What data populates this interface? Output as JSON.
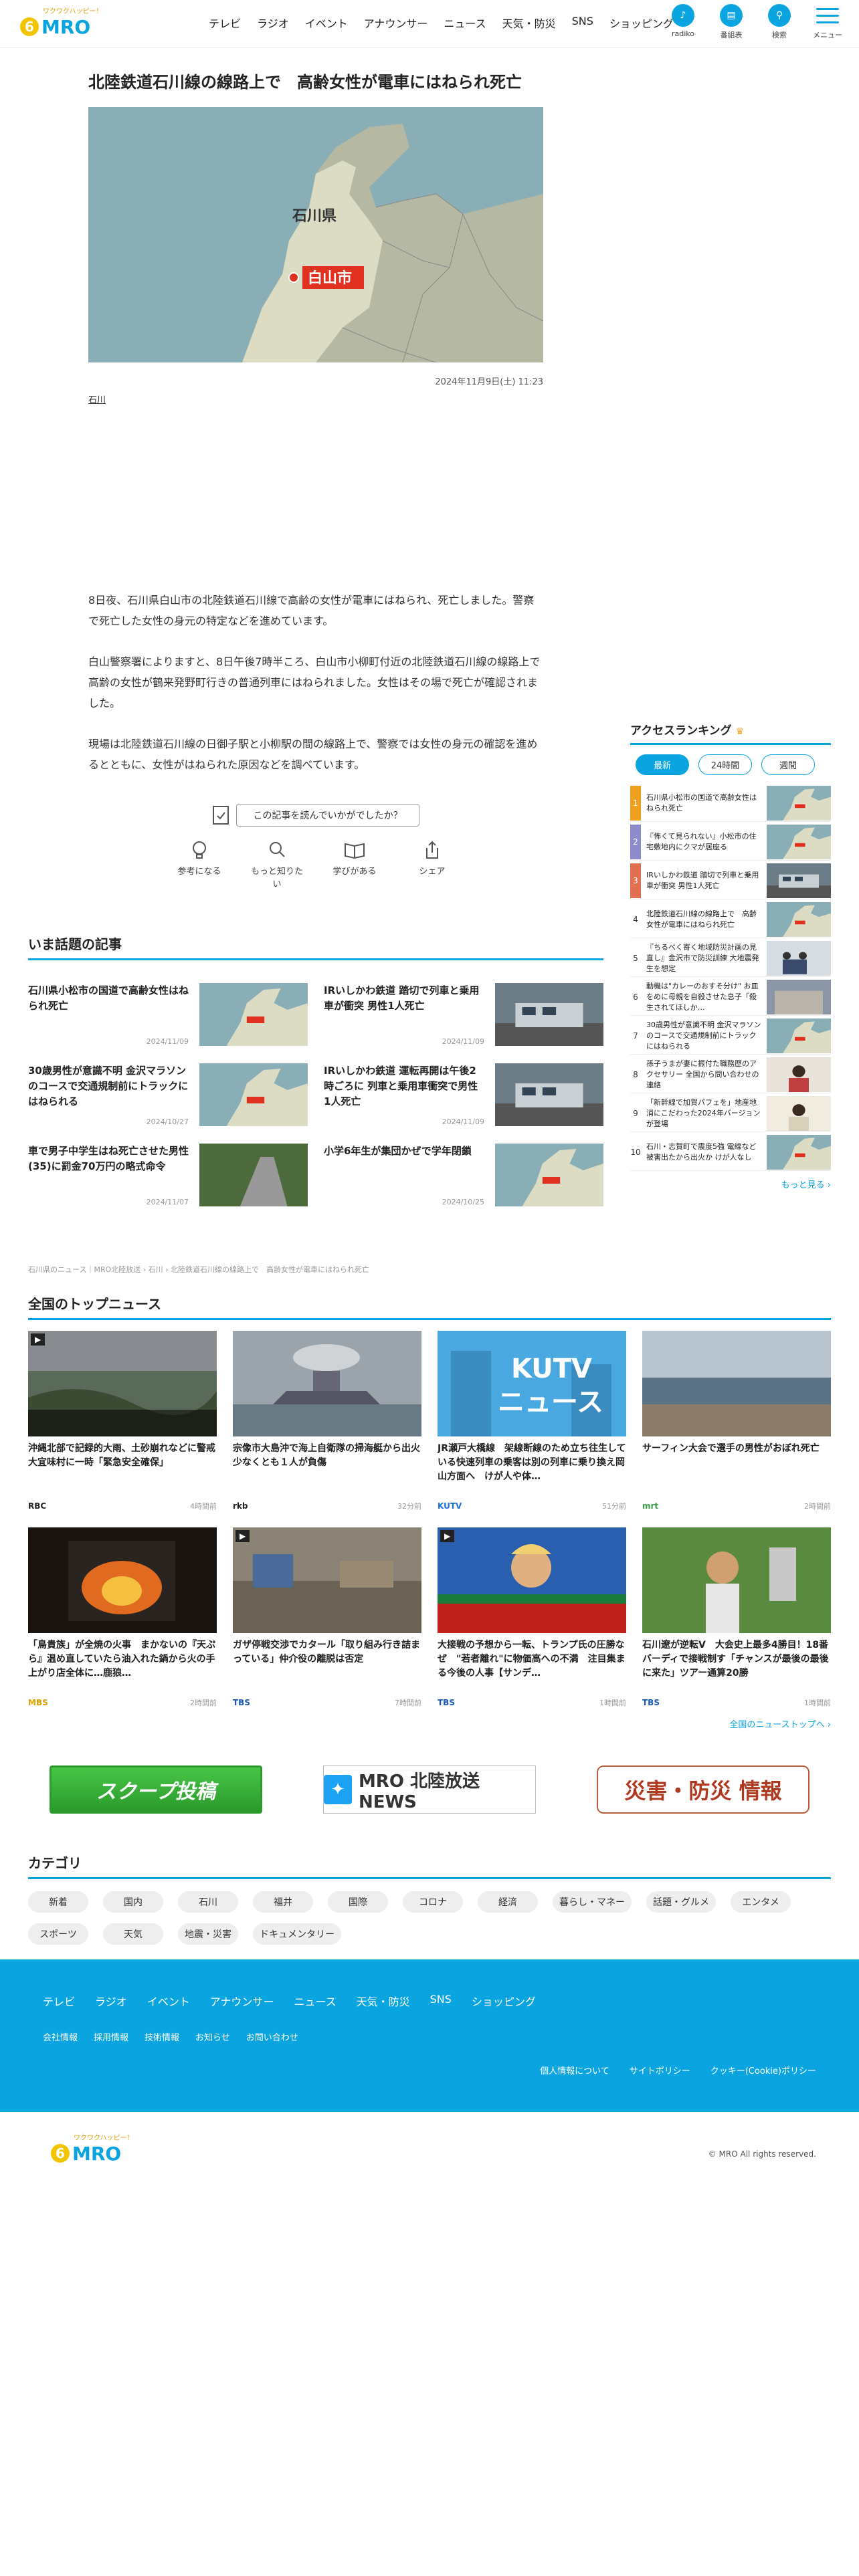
{
  "header": {
    "logo_text": "MRO",
    "logo_tagline": "北陸放送",
    "nav": [
      "テレビ",
      "ラジオ",
      "イベント",
      "アナウンサー",
      "ニュース",
      "天気・防災",
      "SNS",
      "ショッピング"
    ],
    "icons": [
      {
        "label": "radiko",
        "icon": "radio-icon"
      },
      {
        "label": "番組表",
        "icon": "calendar-icon"
      },
      {
        "label": "検索",
        "icon": "search-icon"
      }
    ],
    "menu_label": "メニュー"
  },
  "article": {
    "title": "北陸鉄道石川線の線路上で　高齢女性が電車にはねられ死亡",
    "map_pref_label": "石川県",
    "map_city_label": "白山市",
    "date": "2024年11月9日(土) 11:23",
    "tag": "石川",
    "paragraphs": [
      "8日夜、石川県白山市の北陸鉄道石川線で高齢の女性が電車にはねられ、死亡しました。警察で死亡した女性の身元の特定などを進めています。",
      "白山警察署によりますと、8日午後7時半ころ、白山市小柳町付近の北陸鉄道石川線の線路上で高齢の女性が鶴来発野町行きの普通列車にはねられました。女性はその場で死亡が確認されました。",
      "現場は北陸鉄道石川線の日御子駅と小柳駅の間の線路上で、警察では女性の身元の確認を進めるとともに、女性がはねられた原因などを調べています。"
    ]
  },
  "reaction": {
    "question": "この記事を読んでいかがでしたか？",
    "buttons": [
      {
        "label": "参考になる",
        "icon": "lightbulb-icon"
      },
      {
        "label": "もっと知りたい",
        "icon": "search-icon"
      },
      {
        "label": "学びがある",
        "icon": "book-icon"
      },
      {
        "label": "シェア",
        "icon": "share-icon"
      }
    ]
  },
  "trending": {
    "heading": "いま話題の記事",
    "items": [
      {
        "title": "石川県小松市の国道で高齢女性はねられ死亡",
        "date": "2024/11/09",
        "thumb": "map"
      },
      {
        "title": "IRいしかわ鉄道 踏切で列車と乗用車が衝突 男性1人死亡",
        "date": "2024/11/09",
        "thumb": "train"
      },
      {
        "title": "30歳男性が意識不明 金沢マラソンのコースで交通規制前にトラックにはねられる",
        "date": "2024/10/27",
        "thumb": "map"
      },
      {
        "title": "IRいしかわ鉄道 運転再開は午後2時ごろに 列車と乗用車衝突で男性1人死亡",
        "date": "2024/11/09",
        "thumb": "train"
      },
      {
        "title": "車で男子中学生はね死亡させた男性(35)に罰金70万円の略式命令",
        "date": "2024/11/07",
        "thumb": "road"
      },
      {
        "title": "小学6年生が集団かぜで学年閉鎖",
        "date": "2024/10/25",
        "thumb": "map"
      }
    ]
  },
  "ranking": {
    "heading": "アクセスランキング",
    "tabs": [
      "最新",
      "24時間",
      "週間"
    ],
    "items": [
      {
        "rank": "1",
        "title": "石川県小松市の国道で高齢女性はねられ死亡",
        "color": "#f0a020",
        "thumb": "map"
      },
      {
        "rank": "2",
        "title": "『怖くて見られない』小松市の住宅敷地内にクマが居座る",
        "color": "#8c8ccc",
        "thumb": "map"
      },
      {
        "rank": "3",
        "title": "IRいしかわ鉄道 踏切で列車と乗用車が衝突 男性1人死亡",
        "color": "#e07050",
        "thumb": "train"
      },
      {
        "rank": "4",
        "title": "北陸鉄道石川線の線路上で　高齢女性が電車にはねられ死亡",
        "color": "#ffffff",
        "thumb": "map"
      },
      {
        "rank": "5",
        "title": "『ちるべく寄く地域防災計画の見直し』金沢市で防災訓練 大地震発生を想定",
        "color": "#ffffff",
        "thumb": "people"
      },
      {
        "rank": "6",
        "title": "動機は\"カレーのおすそ分け\" お皿をめに母親を自殺させた息子「殺生されてほしか…",
        "color": "#ffffff",
        "thumb": "building"
      },
      {
        "rank": "7",
        "title": "30歳男性が意識不明 金沢マラソンのコースで交通規制前にトラックにはねられる",
        "color": "#ffffff",
        "thumb": "map"
      },
      {
        "rank": "8",
        "title": "孫子うまが妻に振付た職務歴のアクセサリー 全国から問い合わせの連絡",
        "color": "#ffffff",
        "thumb": "person"
      },
      {
        "rank": "9",
        "title": "「新幹線で加賀パフェを」地産地消にこだわった2024年バージョンが登場",
        "color": "#ffffff",
        "thumb": "person2"
      },
      {
        "rank": "10",
        "title": "石川・志賀町で震度5強 電線など被害出たから出火か けが人なし",
        "color": "#ffffff",
        "thumb": "map"
      }
    ],
    "more": "もっと見る ›"
  },
  "breadcrumb": "石川県のニュース｜MRO北陸放送 › 石川 › 北陸鉄道石川線の線路上で　高齢女性が電車にはねられ死亡",
  "national": {
    "heading": "全国のトップニュース",
    "items": [
      {
        "title": "沖縄北部で記録的大雨、土砂崩れなどに警戒　大宜味村に一時「緊急安全確保」",
        "source": "RBC",
        "time": "4時間前",
        "source_color": "#222222",
        "thumb": "storm",
        "video": true
      },
      {
        "title": "宗像市大島沖で海上自衛隊の掃海艇から出火　少なくとも１人が負傷",
        "source": "rkb",
        "time": "32分前",
        "source_color": "#222222",
        "thumb": "ship",
        "video": false
      },
      {
        "title": "JR瀬戸大橋線　架線断線のため立ち往生している快速列車の乗客は別の列車に乗り換え岡山方面へ　けが人や体…",
        "source": "KUTV",
        "time": "51分前",
        "source_color": "#1a6ed8",
        "thumb": "kutv",
        "video": false
      },
      {
        "title": "サーフィン大会で選手の男性がおぼれ死亡",
        "source": "mrt",
        "time": "2時間前",
        "source_color": "#3aa04a",
        "thumb": "beach",
        "video": false
      },
      {
        "title": "「鳥貴族」が全焼の火事　まかないの『天ぷら』温め直していたら油入れた鍋から火の手上がり店全体に…鹿狼…",
        "source": "MBS",
        "time": "2時間前",
        "source_color": "#e0a000",
        "thumb": "fire",
        "video": false
      },
      {
        "title": "ガザ停戦交渉でカタール「取り組み行き詰まっている」仲介役の離脱は否定",
        "source": "TBS",
        "time": "7時間前",
        "source_color": "#1a5bb8",
        "thumb": "ruins",
        "video": true
      },
      {
        "title": "大接戦の予想から一転、トランプ氏の圧勝なぜ　\"若者離れ\"に物価高への不満　注目集まる今後の人事【サンデ…",
        "source": "TBS",
        "time": "1時間前",
        "source_color": "#1a5bb8",
        "thumb": "trump",
        "video": true
      },
      {
        "title": "石川遼が逆転V　大会史上最多4勝目！18番バーディで接戦制す「チャンスが最後の最後に来た」ツアー通算20勝",
        "source": "TBS",
        "time": "1時間前",
        "source_color": "#1a5bb8",
        "thumb": "golf",
        "video": false
      }
    ],
    "more": "全国のニューストップへ ›"
  },
  "banners": {
    "scoop": "スクープ投稿",
    "news": "MRO 北陸放送 NEWS",
    "bousai": "災害・防災 情報"
  },
  "categories": {
    "heading": "カテゴリ",
    "items": [
      "新着",
      "国内",
      "石川",
      "福井",
      "国際",
      "コロナ",
      "経済",
      "暮らし・マネー",
      "話題・グルメ",
      "エンタメ",
      "スポーツ",
      "天気",
      "地震・災害",
      "ドキュメンタリー"
    ]
  },
  "footer": {
    "nav1": [
      "テレビ",
      "ラジオ",
      "イベント",
      "アナウンサー",
      "ニュース",
      "天気・防災",
      "SNS",
      "ショッピング"
    ],
    "nav2": [
      "会社情報",
      "採用情報",
      "技術情報",
      "お知らせ",
      "お問い合わせ"
    ],
    "nav3": [
      "個人情報について",
      "サイトポリシー",
      "クッキー(Cookie)ポリシー"
    ],
    "copyright": "© MRO All rights reserved."
  },
  "colors": {
    "accent": "#0aa5e0",
    "map_land": "#b5b8a2",
    "map_sea": "#8aaeb6",
    "pin": "#e03020"
  }
}
